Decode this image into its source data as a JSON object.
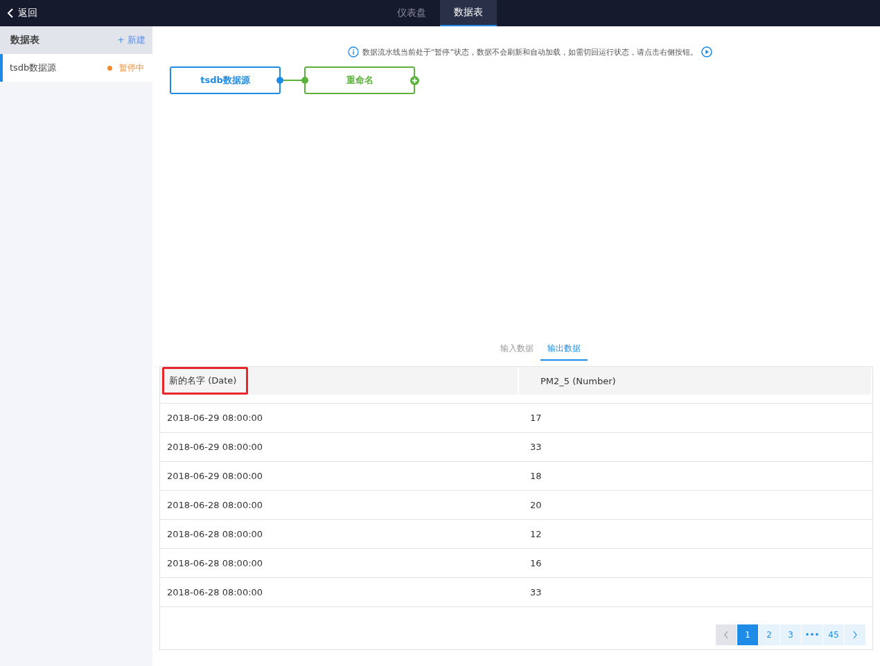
{
  "top_bar": {
    "back": "返回",
    "tabs": [
      {
        "label": "仪表盘",
        "selected": false
      },
      {
        "label": "数据表",
        "selected": true
      }
    ]
  },
  "sidebar": {
    "title": "数据表",
    "new_button": "+ 新建",
    "items": [
      {
        "label": "tsdb数据源",
        "status": "暂停中",
        "color": "#f5892a",
        "selected": true
      }
    ]
  },
  "notice": "数据流水线当前处于“暂停”状态，数据不会刷新和自动加载，如需切回运行状态，请点击右侧按钮。",
  "pipeline": {
    "nodes": [
      {
        "label": "tsdb数据源",
        "kind": "source"
      },
      {
        "label": "重命名",
        "kind": "transform"
      }
    ]
  },
  "data_tabs": [
    {
      "label": "输入数据",
      "selected": false
    },
    {
      "label": "输出数据",
      "selected": true
    }
  ],
  "table": {
    "columns": [
      {
        "label": "新的名字 (Date)",
        "highlighted": true
      },
      {
        "label": "PM2_5 (Number)",
        "highlighted": false
      }
    ],
    "rows": [
      [
        "2018-06-29 08:00:00",
        "17"
      ],
      [
        "2018-06-29 08:00:00",
        "33"
      ],
      [
        "2018-06-29 08:00:00",
        "18"
      ],
      [
        "2018-06-28 08:00:00",
        "20"
      ],
      [
        "2018-06-28 08:00:00",
        "12"
      ],
      [
        "2018-06-28 08:00:00",
        "16"
      ],
      [
        "2018-06-28 08:00:00",
        "33"
      ]
    ]
  },
  "pagination": {
    "prev_disabled": true,
    "pages": [
      {
        "label": "1",
        "selected": true
      },
      {
        "label": "2",
        "selected": false
      },
      {
        "label": "3",
        "selected": false
      },
      {
        "label": "•••",
        "selected": false
      },
      {
        "label": "45",
        "selected": false
      }
    ]
  }
}
